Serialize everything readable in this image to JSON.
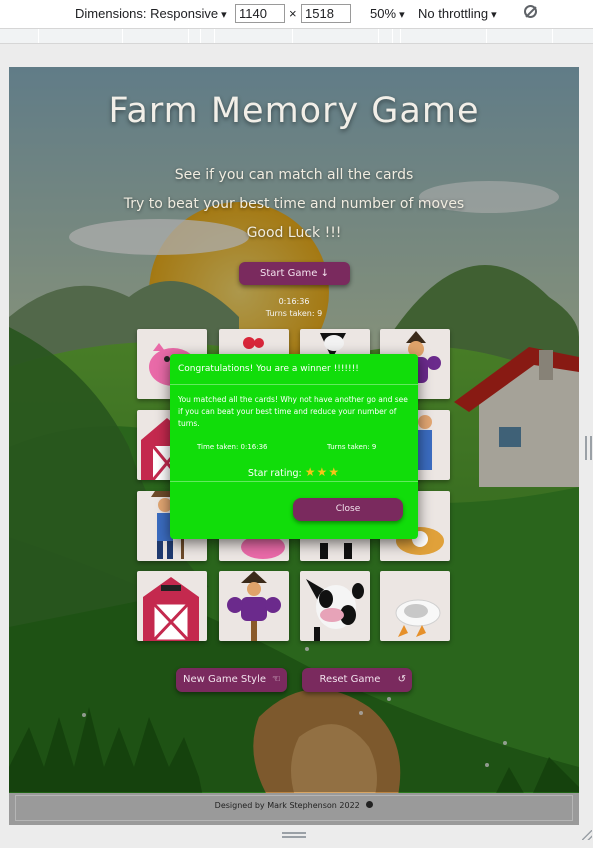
{
  "devtools": {
    "dimensions_label": "Dimensions: Responsive",
    "width": "1140",
    "times": "×",
    "height": "1518",
    "zoom": "50%",
    "throttling": "No throttling",
    "rotate_icon": "rotate-icon"
  },
  "page": {
    "title": "Farm Memory Game",
    "subtitle_1": "See if you can match all the cards",
    "subtitle_2": "Try to beat your best time and number of moves",
    "subtitle_3": "Good Luck !!!",
    "start_button": "Start Game ↓",
    "timer": "0:16:36",
    "turns": "Turns taken: 9",
    "new_game_style_button": "New Game Style",
    "reset_game_button": "Reset Game",
    "footer": "Designed by Mark Stephenson 2022",
    "cards": [
      "pig",
      "hen",
      "cow",
      "scarecrow",
      "barn",
      "hen",
      "farmer",
      "farmer",
      "farmer",
      "pig",
      "cow",
      "chicken",
      "barn",
      "scarecrow",
      "cow",
      "goose"
    ]
  },
  "modal": {
    "title": "Congratulations! You are a winner !!!!!!!",
    "message": "You matched all the cards! Why not have another go and see if you can beat your best time and reduce your number of turns.",
    "time_taken": "Time taken: 0:16:36",
    "turns_taken": "Turns taken: 9",
    "star_rating": "Star rating:",
    "stars": "★★★",
    "close_button": "Close"
  },
  "colors": {
    "button": "#7a2a5e",
    "modal": "#11dd0a"
  }
}
